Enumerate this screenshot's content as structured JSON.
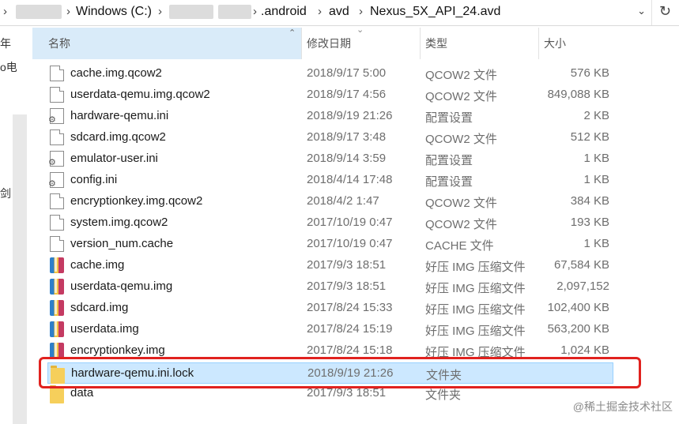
{
  "address_bar": {
    "drive": "Windows (C:)",
    "crumbs": [
      ".android",
      "avd",
      "Nexus_5X_API_24.avd"
    ],
    "refresh_icon": "refresh-icon"
  },
  "nav": {
    "visible_chars": [
      "年",
      "o电",
      "剑"
    ]
  },
  "columns": {
    "name": "名称",
    "date": "修改日期",
    "type": "类型",
    "size": "大小"
  },
  "files": [
    {
      "name": "cache.img.qcow2",
      "date": "2018/9/17 5:00",
      "type": "QCOW2 文件",
      "size": "576 KB",
      "icon": "file"
    },
    {
      "name": "userdata-qemu.img.qcow2",
      "date": "2018/9/17 4:56",
      "type": "QCOW2 文件",
      "size": "849,088 KB",
      "icon": "file"
    },
    {
      "name": "hardware-qemu.ini",
      "date": "2018/9/19 21:26",
      "type": "配置设置",
      "size": "2 KB",
      "icon": "gear"
    },
    {
      "name": "sdcard.img.qcow2",
      "date": "2018/9/17 3:48",
      "type": "QCOW2 文件",
      "size": "512 KB",
      "icon": "file"
    },
    {
      "name": "emulator-user.ini",
      "date": "2018/9/14 3:59",
      "type": "配置设置",
      "size": "1 KB",
      "icon": "gear"
    },
    {
      "name": "config.ini",
      "date": "2018/4/14 17:48",
      "type": "配置设置",
      "size": "1 KB",
      "icon": "gear"
    },
    {
      "name": "encryptionkey.img.qcow2",
      "date": "2018/4/2 1:47",
      "type": "QCOW2 文件",
      "size": "384 KB",
      "icon": "file"
    },
    {
      "name": "system.img.qcow2",
      "date": "2017/10/19 0:47",
      "type": "QCOW2 文件",
      "size": "193 KB",
      "icon": "file"
    },
    {
      "name": "version_num.cache",
      "date": "2017/10/19 0:47",
      "type": "CACHE 文件",
      "size": "1 KB",
      "icon": "file"
    },
    {
      "name": "cache.img",
      "date": "2017/9/3 18:51",
      "type": "好压 IMG 压缩文件",
      "size": "67,584 KB",
      "icon": "zip"
    },
    {
      "name": "userdata-qemu.img",
      "date": "2017/9/3 18:51",
      "type": "好压 IMG 压缩文件",
      "size": "2,097,152",
      "icon": "zip"
    },
    {
      "name": "sdcard.img",
      "date": "2017/8/24 15:33",
      "type": "好压 IMG 压缩文件",
      "size": "102,400 KB",
      "icon": "zip"
    },
    {
      "name": "userdata.img",
      "date": "2017/8/24 15:19",
      "type": "好压 IMG 压缩文件",
      "size": "563,200 KB",
      "icon": "zip"
    },
    {
      "name": "encryptionkey.img",
      "date": "2017/8/24 15:18",
      "type": "好压 IMG 压缩文件",
      "size": "1,024 KB",
      "icon": "zip"
    },
    {
      "name": "hardware-qemu.ini.lock",
      "date": "2018/9/19 21:26",
      "type": "文件夹",
      "size": "",
      "icon": "folder",
      "selected": true
    },
    {
      "name": "data",
      "date": "2017/9/3 18:51",
      "type": "文件夹",
      "size": "",
      "icon": "folder"
    }
  ],
  "watermark": "@稀土掘金技术社区"
}
